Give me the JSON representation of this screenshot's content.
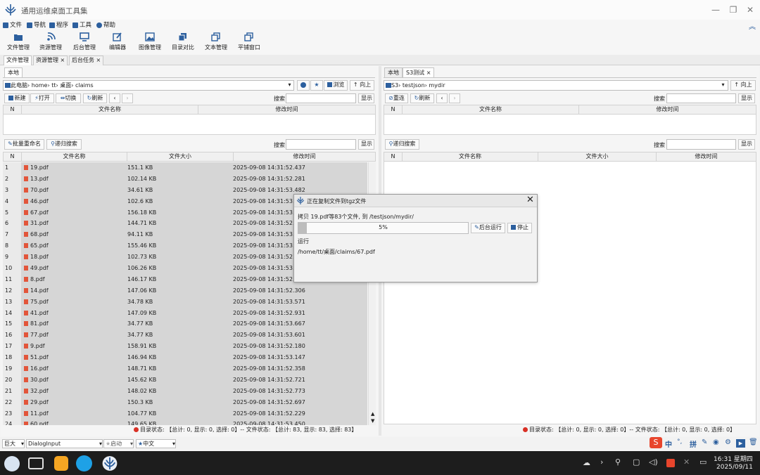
{
  "app": {
    "title": "通用运维桌面工具集"
  },
  "menus": [
    "文件",
    "导航",
    "程序",
    "工具",
    "帮助"
  ],
  "toolbar": [
    "文件管理",
    "资源管理",
    "后台管理",
    "编辑器",
    "图像管理",
    "目录对比",
    "文本管理",
    "平铺窗口"
  ],
  "doc_tabs": [
    {
      "label": "文件管理",
      "close": ""
    },
    {
      "label": "资源管理",
      "close": "×"
    },
    {
      "label": "后台任务",
      "close": "×"
    }
  ],
  "left": {
    "tab": "本地",
    "path_root": "此电脑",
    "path_parts": [
      "home",
      "tt",
      "桌面",
      "claims"
    ],
    "browse": "浏览",
    "up": "向上",
    "buttons": [
      "新建",
      "打开",
      "切换",
      "刷新"
    ],
    "search_label": "搜索",
    "show": "显示",
    "top_headers": [
      "N",
      "文件名称",
      "修改时间"
    ],
    "batch_rename": "批量重命名",
    "recursive_search": "递归搜索",
    "headers": [
      "N",
      "文件名称",
      "文件大小",
      "修改时间"
    ],
    "rows": [
      [
        "1",
        "19.pdf",
        "151.1 KB",
        "2025-09-08 14:31:52.437"
      ],
      [
        "2",
        "13.pdf",
        "102.14 KB",
        "2025-09-08 14:31:52.281"
      ],
      [
        "3",
        "70.pdf",
        "34.61 KB",
        "2025-09-08 14:31:53.482"
      ],
      [
        "4",
        "46.pdf",
        "102.6 KB",
        "2025-09-08 14:31:53.05"
      ],
      [
        "5",
        "67.pdf",
        "156.18 KB",
        "2025-09-08 14:31:53.4"
      ],
      [
        "6",
        "31.pdf",
        "144.71 KB",
        "2025-09-08 14:31:52.74"
      ],
      [
        "7",
        "68.pdf",
        "94.11 KB",
        "2025-09-08 14:31:53.4"
      ],
      [
        "8",
        "65.pdf",
        "155.46 KB",
        "2025-09-08 14:31:53.3"
      ],
      [
        "9",
        "18.pdf",
        "102.73 KB",
        "2025-09-08 14:31:52.4"
      ],
      [
        "10",
        "49.pdf",
        "106.26 KB",
        "2025-09-08 14:31:53.1"
      ],
      [
        "11",
        "8.pdf",
        "146.17 KB",
        "2025-09-08 14:31:52.1"
      ],
      [
        "12",
        "14.pdf",
        "147.06 KB",
        "2025-09-08 14:31:52.306"
      ],
      [
        "13",
        "75.pdf",
        "34.78 KB",
        "2025-09-08 14:31:53.571"
      ],
      [
        "14",
        "41.pdf",
        "147.09 KB",
        "2025-09-08 14:31:52.931"
      ],
      [
        "15",
        "81.pdf",
        "34.77 KB",
        "2025-09-08 14:31:53.667"
      ],
      [
        "16",
        "77.pdf",
        "34.77 KB",
        "2025-09-08 14:31:53.601"
      ],
      [
        "17",
        "9.pdf",
        "158.91 KB",
        "2025-09-08 14:31:52.180"
      ],
      [
        "18",
        "51.pdf",
        "146.94 KB",
        "2025-09-08 14:31:53.147"
      ],
      [
        "19",
        "16.pdf",
        "148.71 KB",
        "2025-09-08 14:31:52.358"
      ],
      [
        "20",
        "30.pdf",
        "145.62 KB",
        "2025-09-08 14:31:52.721"
      ],
      [
        "21",
        "32.pdf",
        "148.02 KB",
        "2025-09-08 14:31:52.773"
      ],
      [
        "22",
        "29.pdf",
        "150.3 KB",
        "2025-09-08 14:31:52.697"
      ],
      [
        "23",
        "11.pdf",
        "104.77 KB",
        "2025-09-08 14:31:52.229"
      ],
      [
        "24",
        "60.pdf",
        "149.65 KB",
        "2025-09-08 14:31:53.450"
      ]
    ],
    "status": "目录状态: 【总计: 0, 显示: 0, 选择: 0】-- 文件状态: 【总计: 83, 显示: 83, 选择: 83】"
  },
  "right": {
    "tabs": [
      {
        "label": "本地",
        "close": ""
      },
      {
        "label": "S3测试",
        "close": "×"
      }
    ],
    "path_root": "S3",
    "path_parts": [
      "testjson",
      "mydir"
    ],
    "up": "向上",
    "buttons": [
      "重连",
      "刷新"
    ],
    "search_label": "搜索",
    "show": "显示",
    "top_headers": [
      "N",
      "文件名称",
      "修改时间"
    ],
    "recursive_search": "递归搜索",
    "headers": [
      "N",
      "文件名称",
      "文件大小",
      "修改时间"
    ],
    "status": "目录状态: 【总计: 0, 显示: 0, 选择: 0】-- 文件状态: 【总计: 0, 显示: 0, 选择: 0】"
  },
  "dialog": {
    "title": "正在复制文件到tgz文件",
    "message": "拷贝 19.pdf等83个文件, 到 /testjson/mydir/",
    "progress_text": "5%",
    "progress": 0.05,
    "background_btn": "后台运行",
    "stop_btn": "停止",
    "running_label": "运行",
    "current_file": "/home/tt/桌面/claims/67.pdf"
  },
  "bottombar": {
    "size": "巨大",
    "input_mode": "DialogInput",
    "hint": "启动",
    "lang": "中文"
  },
  "ime": [
    "中",
    "°,",
    "拼"
  ],
  "taskbar": {
    "time": "16:31 星期四",
    "date": "2025/09/11"
  },
  "colors": {
    "accent": "#2c5f9e",
    "pdf": "#e2553a",
    "status_dot": "#d93025",
    "ime": "#e8452c"
  }
}
